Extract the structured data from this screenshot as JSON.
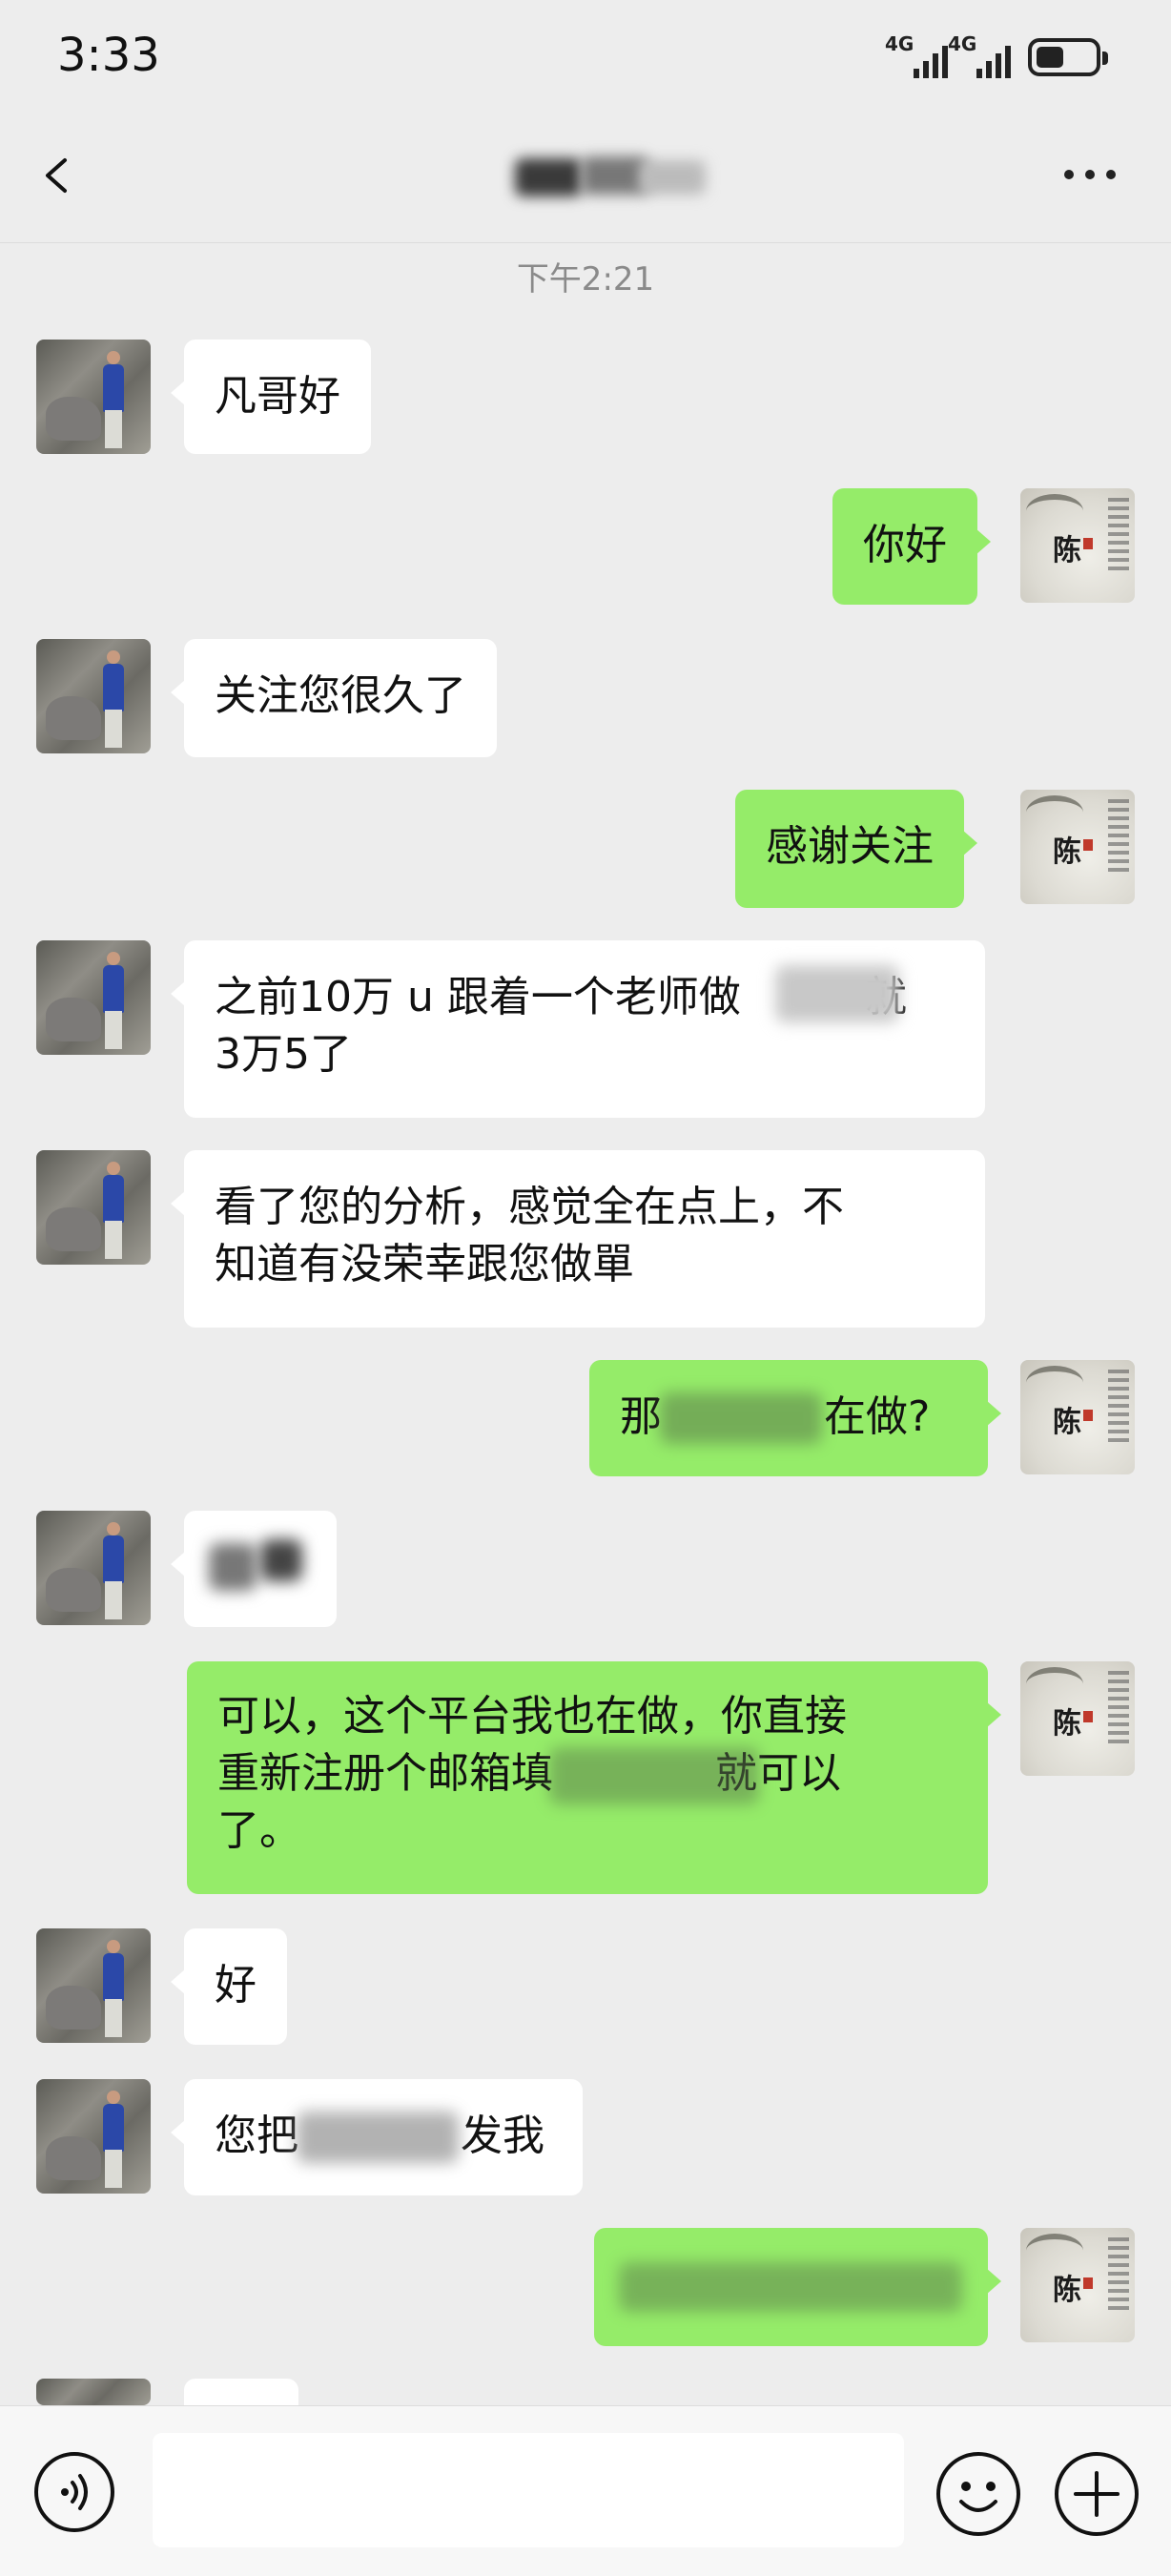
{
  "status_bar": {
    "time": "3:33",
    "signal_1": "4G",
    "signal_2": "4G"
  },
  "header": {
    "title": "",
    "back_icon": "chevron-left-icon",
    "more_icon": "more-icon"
  },
  "chat": {
    "timestamp": "下午2:21",
    "messages": [
      {
        "side": "left",
        "text": "凡哥好"
      },
      {
        "side": "right",
        "text": "你好"
      },
      {
        "side": "left",
        "text": "关注您很久了"
      },
      {
        "side": "right",
        "text": "感谢关注"
      },
      {
        "side": "left",
        "line1": "之前10万 u 跟着一个老师做",
        "line1_tail": "就",
        "line2": "3万5了"
      },
      {
        "side": "left",
        "line1": "看了您的分析，感觉全在点上，不",
        "line2": "知道有没荣幸跟您做單"
      },
      {
        "side": "right",
        "text_a": "那",
        "text_b": "在做?"
      },
      {
        "side": "left",
        "text": ""
      },
      {
        "side": "right",
        "line1": "可以，这个平台我也在做，你直接",
        "line2_a": "重新注册个邮箱填",
        "line2_b": "就可以",
        "line3": "了。"
      },
      {
        "side": "left",
        "text": "好"
      },
      {
        "side": "left",
        "text_a": "您把",
        "text_b": "发我"
      },
      {
        "side": "right",
        "text": ""
      }
    ]
  },
  "input_bar": {
    "voice_icon": "voice-icon",
    "placeholder": "",
    "emoji_icon": "emoji-icon",
    "plus_icon": "plus-icon"
  },
  "colors": {
    "background": "#ededed",
    "sent_bubble": "#95ec69",
    "received_bubble": "#ffffff"
  }
}
